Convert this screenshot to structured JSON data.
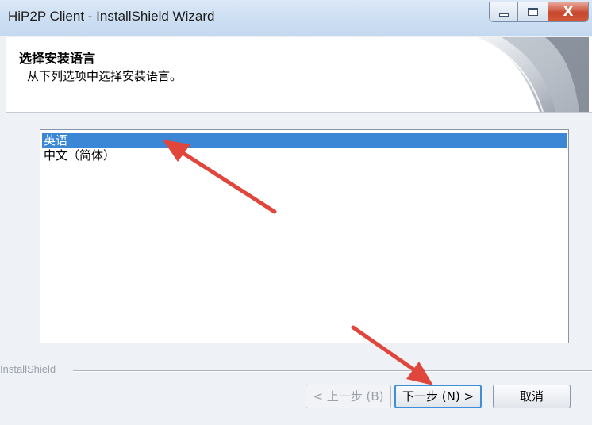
{
  "window": {
    "title": "HiP2P Client - InstallShield Wizard",
    "close_symbol": "X"
  },
  "header": {
    "title": "选择安装语言",
    "subtitle": "从下列选项中选择安装语言。"
  },
  "language_list": {
    "items": [
      {
        "label": "英语",
        "selected": true
      },
      {
        "label": "中文（简体）",
        "selected": false
      }
    ]
  },
  "footer": {
    "brand": "InstallShield"
  },
  "buttons": {
    "back_label": "< 上一步 (B)",
    "next_label": "下一步 (N) >",
    "cancel_label": "取消"
  },
  "colors": {
    "selection": "#3b87d6",
    "annotation_arrow": "#e0463c",
    "focus_border": "#3c8fd8"
  }
}
